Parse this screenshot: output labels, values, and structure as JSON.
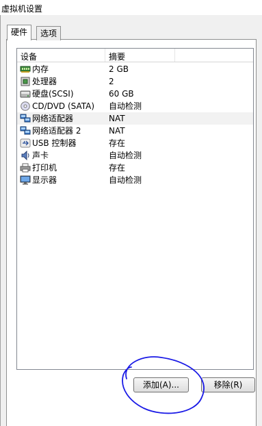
{
  "window": {
    "title": "虚拟机设置"
  },
  "tabs": [
    {
      "label": "硬件",
      "active": true
    },
    {
      "label": "选项",
      "active": false
    }
  ],
  "table": {
    "columns": [
      "设备",
      "摘要"
    ],
    "rows": [
      {
        "device": "内存",
        "summary": "2 GB",
        "icon": "memory-icon"
      },
      {
        "device": "处理器",
        "summary": "2",
        "icon": "processor-icon"
      },
      {
        "device": "硬盘(SCSI)",
        "summary": "60 GB",
        "icon": "hard-disk-icon"
      },
      {
        "device": "CD/DVD (SATA)",
        "summary": "自动检测",
        "icon": "cd-dvd-icon"
      },
      {
        "device": "网络适配器",
        "summary": "NAT",
        "icon": "network-adapter-icon",
        "selected": true
      },
      {
        "device": "网络适配器 2",
        "summary": "NAT",
        "icon": "network-adapter-icon"
      },
      {
        "device": "USB 控制器",
        "summary": "存在",
        "icon": "usb-icon"
      },
      {
        "device": "声卡",
        "summary": "自动检测",
        "icon": "sound-card-icon"
      },
      {
        "device": "打印机",
        "summary": "存在",
        "icon": "printer-icon"
      },
      {
        "device": "显示器",
        "summary": "自动检测",
        "icon": "monitor-icon"
      }
    ]
  },
  "buttons": {
    "add_label": "添加(A)...",
    "remove_label": "移除(R)"
  },
  "annotation": {
    "color": "#1a1ae6"
  }
}
